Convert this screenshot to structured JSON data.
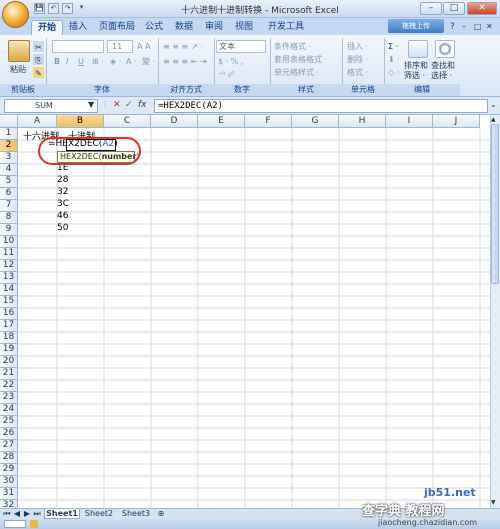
{
  "window": {
    "title": "十六进制十进制转换 - Microsoft Excel",
    "minimize": "–",
    "maximize": "□",
    "close": "✕"
  },
  "qat": {
    "save": "💾",
    "undo": "↶",
    "redo": "↷",
    "more": "▾"
  },
  "tabs": [
    "开始",
    "插入",
    "页面布局",
    "公式",
    "数据",
    "审阅",
    "视图",
    "开发工具"
  ],
  "upload_button": "拖拽上传",
  "ribbon": {
    "groups": {
      "clipboard": "剪贴板",
      "font": "字体",
      "alignment": "对齐方式",
      "number": "数字",
      "styles": "样式",
      "cells": "单元格",
      "editing": "编辑"
    },
    "paste_label": "粘贴",
    "font_size": "11",
    "number_format": "文本",
    "styles_items": [
      "条件格式 ·",
      "套用表格格式 ·",
      "单元格样式 ·"
    ],
    "cells_items": [
      "插入 ·",
      "删除 ·",
      "格式 ·"
    ],
    "sort_filter": "排序和\n筛选 ·",
    "find_select": "查找和\n选择 ·",
    "sigma": "Σ ·"
  },
  "formula_bar": {
    "name_box": "SUM",
    "cancel": "✕",
    "enter": "✓",
    "fx": "fx",
    "formula": "=HEX2DEC(A2)"
  },
  "columns": [
    "A",
    "B",
    "C",
    "D",
    "E",
    "F",
    "G",
    "H",
    "I",
    "J"
  ],
  "rows": [
    "1",
    "2",
    "3",
    "4",
    "5",
    "6",
    "7",
    "8",
    "9",
    "10",
    "11",
    "12",
    "13",
    "14",
    "15",
    "16",
    "17",
    "18",
    "19",
    "20",
    "21",
    "22",
    "23",
    "24",
    "25",
    "26",
    "27",
    "28",
    "29",
    "30",
    "31",
    "32"
  ],
  "cells": {
    "A1": "十六进制",
    "B1": "十进制",
    "B2_prefix": "=HEX2DEC(",
    "B2_ref": "A2",
    "B2_suffix": ")",
    "A4": "1E",
    "A5": "28",
    "A6": "32",
    "A7": "3C",
    "A8": "46",
    "A9": "50"
  },
  "tooltip": {
    "func": "HEX2DEC(",
    "arg": "number",
    "close": ")"
  },
  "sheets": [
    "Sheet1",
    "Sheet2",
    "Sheet3"
  ],
  "sheet_nav": [
    "⏮",
    "◀",
    "▶",
    "⏭"
  ],
  "watermark": {
    "site": "jb51.net",
    "brand": "查字典 教程网",
    "url": "jiaocheng.chazidian.com"
  },
  "colors": {
    "accent": "#15428b",
    "highlight_circle": "#e0302a",
    "ref_blue": "#1c56c8"
  }
}
